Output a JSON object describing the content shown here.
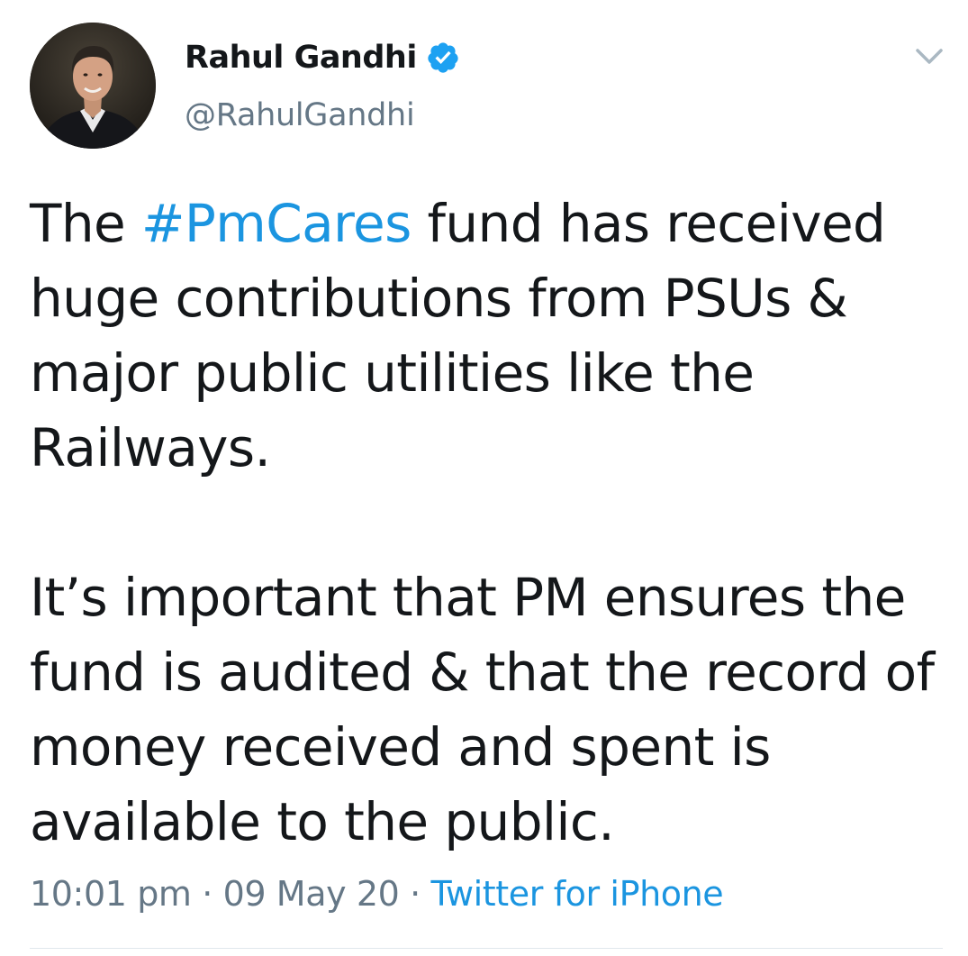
{
  "colors": {
    "link": "#1b95e0",
    "secondary_text": "#657786",
    "primary_text": "#14171a",
    "verified_badge": "#1da1f2",
    "divider": "#e1e8ed"
  },
  "author": {
    "name": "Rahul Gandhi",
    "handle": "@RahulGandhi",
    "verified": true,
    "avatar_icon": "profile-photo",
    "verified_icon": "verified-badge-icon"
  },
  "menu_icon": "chevron-down-icon",
  "tweet": {
    "paragraph1": {
      "before": "The ",
      "hashtag": "#PmCares",
      "after": " fund has received huge contributions from PSUs & major public utilities like the Railways."
    },
    "paragraph2": "It’s important that PM ensures the fund is audited & that the record of money received and spent is available to the public."
  },
  "meta": {
    "time": "10:01 pm",
    "separator": " · ",
    "date": "09 May 20",
    "source": "Twitter for iPhone"
  }
}
